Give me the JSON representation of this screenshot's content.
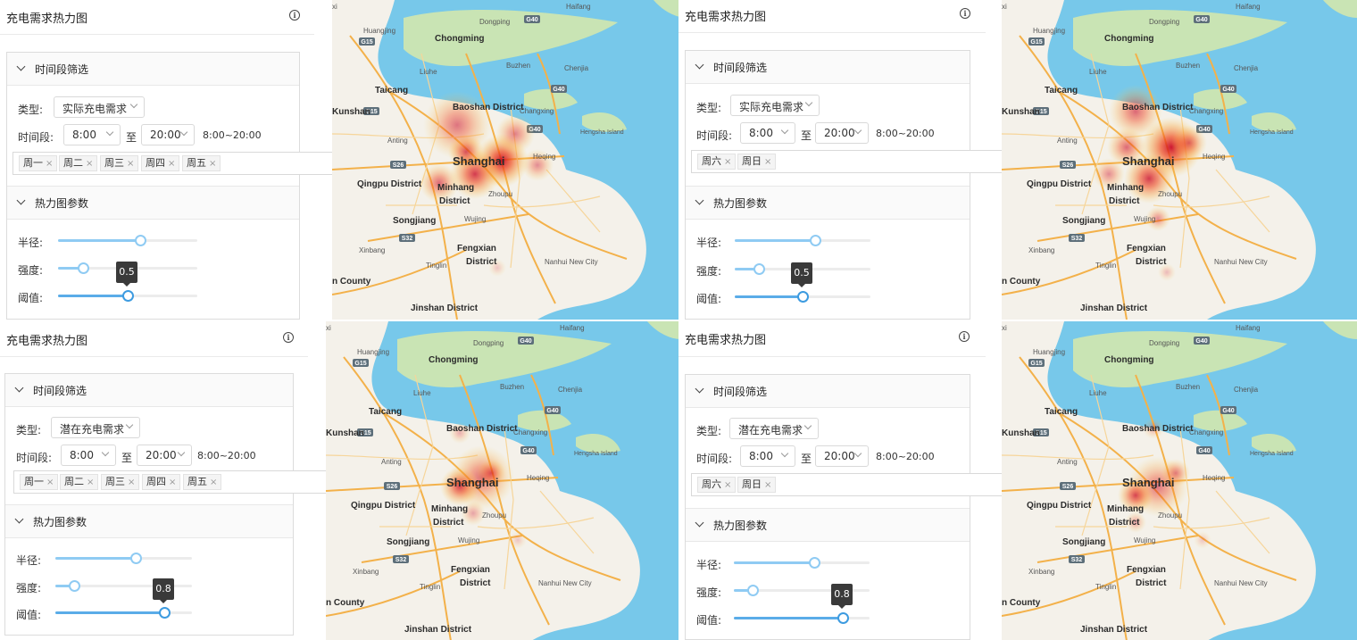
{
  "panels": [
    {
      "title": "充电需求热力图",
      "filter_section": "时间段筛选",
      "type_label": "类型:",
      "type_value": "实际充电需求",
      "time_label": "时间段:",
      "start": "8:00",
      "to": "至",
      "end": "20:00",
      "range": "8:00~20:00",
      "days": [
        "周一",
        "周二",
        "周三",
        "周四",
        "周五"
      ],
      "params_section": "热力图参数",
      "radius_label": "半径:",
      "intensity_label": "强度:",
      "threshold_label": "阈值:",
      "radius_fraction": 0.59,
      "intensity_fraction": 0.18,
      "threshold_fraction": 0.5,
      "threshold_tooltip": "0.5"
    },
    {
      "title": "充电需求热力图",
      "filter_section": "时间段筛选",
      "type_label": "类型:",
      "type_value": "实际充电需求",
      "time_label": "时间段:",
      "start": "8:00",
      "to": "至",
      "end": "20:00",
      "range": "8:00~20:00",
      "days": [
        "周六",
        "周日"
      ],
      "params_section": "热力图参数",
      "radius_label": "半径:",
      "intensity_label": "强度:",
      "threshold_label": "阈值:",
      "radius_fraction": 0.59,
      "intensity_fraction": 0.18,
      "threshold_fraction": 0.5,
      "threshold_tooltip": "0.5"
    },
    {
      "title": "充电需求热力图",
      "filter_section": "时间段筛选",
      "type_label": "类型:",
      "type_value": "潜在充电需求",
      "time_label": "时间段:",
      "start": "8:00",
      "to": "至",
      "end": "20:00",
      "range": "8:00~20:00",
      "days": [
        "周一",
        "周二",
        "周三",
        "周四",
        "周五"
      ],
      "params_section": "热力图参数",
      "radius_label": "半径:",
      "intensity_label": "强度:",
      "threshold_label": "阈值:",
      "radius_fraction": 0.59,
      "intensity_fraction": 0.14,
      "threshold_fraction": 0.8,
      "threshold_tooltip": "0.8"
    },
    {
      "title": "充电需求热力图",
      "filter_section": "时间段筛选",
      "type_label": "类型:",
      "type_value": "潜在充电需求",
      "time_label": "时间段:",
      "start": "8:00",
      "to": "至",
      "end": "20:00",
      "range": "8:00~20:00",
      "days": [
        "周六",
        "周日"
      ],
      "params_section": "热力图参数",
      "radius_label": "半径:",
      "intensity_label": "强度:",
      "threshold_label": "阈值:",
      "radius_fraction": 0.59,
      "intensity_fraction": 0.14,
      "threshold_fraction": 0.8,
      "threshold_tooltip": "0.8"
    }
  ],
  "map": {
    "labels": {
      "dongping": "Dongping",
      "haifang": "Haifang",
      "huangjing": "Huangjing",
      "chongming": "Chongming",
      "buzhen": "Buzhen",
      "chenjia": "Chenjia",
      "liuhe": "Liuhe",
      "taicang": "Taicang",
      "kunshan": "Kunshan",
      "baoshan": "Baoshan District",
      "changxing": "Changxing",
      "hengsha": "Hengsha Island",
      "anting": "Anting",
      "shanghai": "Shanghai",
      "heqing": "Heqing",
      "qingpu": "Qingpu District",
      "minhang_1": "Minhang",
      "minhang_2": "District",
      "zhoupu": "Zhoupu",
      "songjiang": "Songjiang",
      "wujing": "Wujing",
      "xinbang": "Xinbang",
      "fengxian_1": "Fengxian",
      "fengxian_2": "District",
      "tinglin": "Tinglin",
      "nanhui": "Nanhui New City",
      "county": "n County",
      "jinshan": "Jinshan District",
      "xi": "xi"
    },
    "roads": [
      "G15",
      "G40",
      "G40",
      "G40",
      "S26",
      "S32",
      "G15"
    ],
    "colors": {
      "water": "#77c8ea",
      "land": "#f4f1ea",
      "island": "#c9e4b4",
      "highway": "#f3b14a",
      "road": "#f6d59a"
    }
  }
}
